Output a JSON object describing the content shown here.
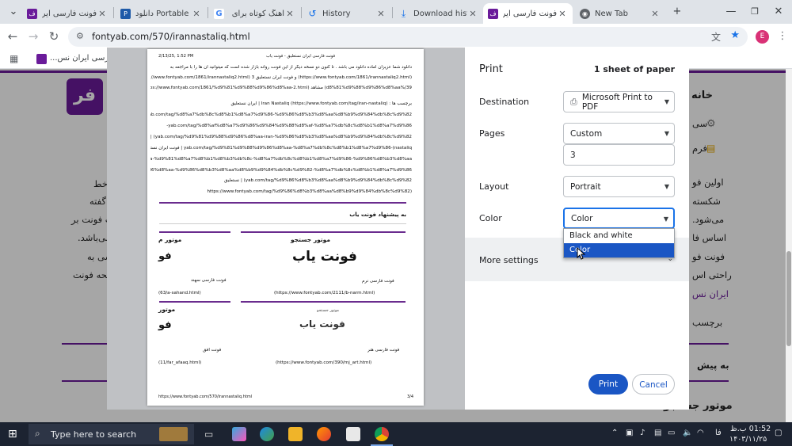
{
  "tabs": [
    {
      "title": "فونت فارسی ایران",
      "icon": "fontyab-icon",
      "active": false
    },
    {
      "title": "دانلود Portable",
      "icon": "portable-icon",
      "active": false
    },
    {
      "title": "آهنگ کوتاه برای",
      "icon": "google-icon",
      "active": false
    },
    {
      "title": "History",
      "icon": "history-icon",
      "active": false
    },
    {
      "title": "Download histo",
      "icon": "download-icon",
      "active": false
    },
    {
      "title": "فونت فارسی ایران",
      "icon": "fontyab-icon",
      "active": true
    },
    {
      "title": "New Tab",
      "icon": "chrome-icon",
      "active": false
    }
  ],
  "address": {
    "url": "fontyab.com/570/irannastaliq.html"
  },
  "bookmarks": {
    "item": "فونت فارسی ایران نس..."
  },
  "avatar": "E",
  "site": {
    "nav_home": "خانه",
    "left_lines": [
      "ی خط",
      "ت گفته",
      "ت فونت بر",
      "می‌باشد.",
      "رسی به",
      "فحه فونت"
    ],
    "right_lines": [
      "سی",
      "فرم",
      "اولین فو",
      "شکسته",
      "می‌شود.",
      "اساس فا",
      "فونت فو",
      "راحتی اس",
      "ایران نس",
      "برچسب"
    ],
    "bottom_right": "به پیش",
    "bottom_center": "موتور جستجو"
  },
  "preview": {
    "header_left": "2/13/25, 1:52 PM",
    "header_center": "فونت فارسی ایران نستعلیق - فونت یاب",
    "lines": [
      "دانلود شما عزیزان آماده دانلود می باشد . تا کنون دو نسخه دیگر از این فونت روانه بازار شده است که میتوانید آن ها را با مراجعه به",
      "(https://www.fontyab.com/1861/irannastaliq2.html) و فونت ایران نستعلیق 3 (https://www.fontyab.com/1861/irannastaliq2.html",
      "39/%d8%81%d9%88%d9%86%d8%aa) مشاهد (https://www.fontyab.com/1861/%d9%81%d9%88%d9%86%d8%aa-2.html",
      "برچسب ها : Iran Nastaliq (https://www.fontyab.com/tag/iran-nastaliq) | ایران نستعلیق",
      "yab.com/tag/%d8%a7%db%8c%d8%b1%d8%a7%d9%86-%d9%86%d8%b3%d8%aa%d8%b9%d9%84%db%8c%d9%82",
      "yab.com/tag/%d8%af%d8%a7%d9%86%d9%84%d9%88%d8%af-%d8%a7%db%8c%d8%b1%d8%a7%d9%86-",
      "yab.com/tag/%d9%81%d9%88%d9%86%d8%aa-iran-%d9%86%d8%b3%d8%aa%d8%b9%d9%84%db%8c%d9%82) | فونت",
      "yab.com/tag/%d9%81%d9%88%d9%86%d8%aa-%d8%a7%db%8c%d8%b1%d8%a7%d9%86-(nastaliq | فونت ایران نستعلیق",
      "31%d9%88%d9%86%d8%aa-%d9%81%d8%a7%d8%b1%d8%b3%db%8c-%d8%a7%db%8c%d8%b1%d8%a7%d9%86-%d9%86%d8%b3%d8%aa",
      "b3%d8%b1%d9%88%d9%86%d8%aa-%d9%86%d8%b3%d8%aa%d8%b9%d9%84%db%8c%d9%82-%d8%a7%db%8c%d8%b1%d8%a7%d9%86",
      "yab.com/tag/%d9%86%d8%b3%d8%aa%d8%b9%d9%84%db%8c%d9%82) | نستعلیق",
      "(https://www.fontyab.com/tag/%d9%86%d8%b3%d8%aa%d8%b9%d9%84%db%8c%d9%82"
    ],
    "suggest_heading": "به پیشنهاد فونت یاب",
    "card1": {
      "title": "موتور جستجو",
      "sample": "فونت یاب",
      "name": "فونت فارسی نرم",
      "url": "(https://www.fontyab.com/2111/b-narm.html)"
    },
    "card2": {
      "title": "موتور م",
      "sample": "فو",
      "name": "فونت فارسی سهند",
      "url": "(63/a-sahand.html)"
    },
    "card3": {
      "title": "موتور",
      "sample": "فو",
      "name": "فونت افق",
      "url": "(11/far_afaaq.html)"
    },
    "card4": {
      "title": "موتور جستجو",
      "sample": "فونت یاب",
      "name": "فونت فارسی هنر",
      "url": "(https://www.fontyab.com/390/mj_art.html)"
    },
    "footer_left": "https://www.fontyab.com/570/irannastaliq.html",
    "footer_right": "3/4"
  },
  "print": {
    "title": "Print",
    "sheets": "1 sheet of paper",
    "destination_label": "Destination",
    "destination_value": "Microsoft Print to PDF",
    "pages_label": "Pages",
    "pages_value": "Custom",
    "pages_input": "3",
    "layout_label": "Layout",
    "layout_value": "Portrait",
    "color_label": "Color",
    "color_value": "Color",
    "color_options": [
      "Black and white",
      "Color"
    ],
    "more_settings": "More settings",
    "print_button": "Print",
    "cancel_button": "Cancel"
  },
  "taskbar": {
    "search_placeholder": "Type here to search",
    "time": "01:52 ب.ظ",
    "date": "۱۴۰۳/۱۱/۲۵",
    "lang": "فا"
  }
}
